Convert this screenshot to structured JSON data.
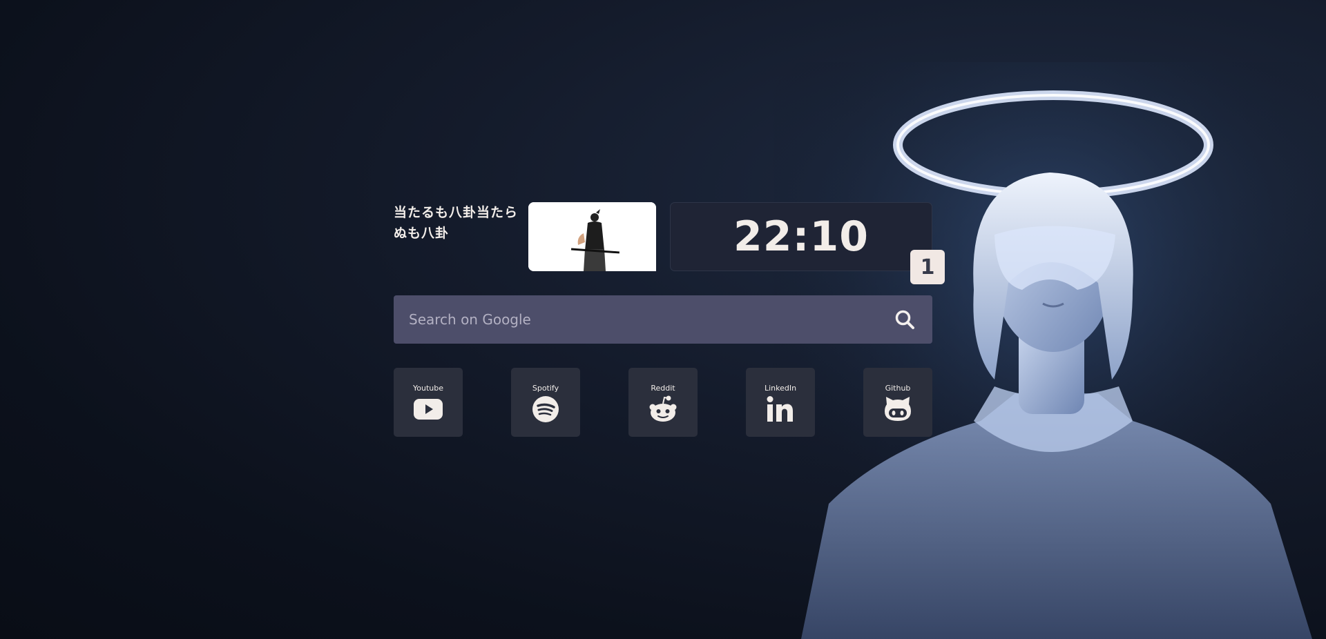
{
  "quote": {
    "text": "当たるも八卦当たらぬも八卦"
  },
  "clock": {
    "time": "22:10"
  },
  "badge": {
    "count": "1"
  },
  "search": {
    "placeholder": "Search on Google",
    "value": ""
  },
  "shortcuts": [
    {
      "label": "Youtube",
      "icon": "youtube-icon"
    },
    {
      "label": "Spotify",
      "icon": "spotify-icon"
    },
    {
      "label": "Reddit",
      "icon": "reddit-icon"
    },
    {
      "label": "LinkedIn",
      "icon": "linkedin-icon"
    },
    {
      "label": "Github",
      "icon": "github-icon"
    }
  ],
  "colors": {
    "background": "#0c111c",
    "text": "#f2ede9",
    "card": "#2b2f3c",
    "search": "#4d4e6a",
    "badge": "#f1e8e4"
  }
}
